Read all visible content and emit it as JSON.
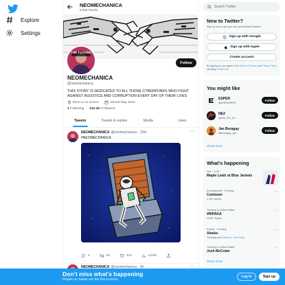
{
  "colors": {
    "accent": "#1d9bf0",
    "text": "#0f1419",
    "muted": "#536471",
    "card_bg": "#f7f9f9"
  },
  "nav": {
    "logo_icon": "twitter-bird-icon",
    "items": [
      {
        "icon": "hashtag-icon",
        "label": "Explore"
      },
      {
        "icon": "gear-icon",
        "label": "Settings"
      }
    ]
  },
  "header": {
    "name": "NEOMECHANICA",
    "tweet_count": "6,369 Tweets"
  },
  "profile": {
    "avatar_text": "THE FUTURE",
    "follow_label": "Follow",
    "name": "NEOMECHANICA",
    "handle": "@neomechanica",
    "bio": "THIS STORY IS DEDICATED TO ALL THOSE CYBERPUNKS WHO FIGHT AGAINST INJUSTICE AND CORRUPTION EVERY DAY OF THEIR LIVES",
    "location": "there is no source",
    "joined": "Joined May 2015",
    "following_count": "1",
    "following_label": "Following",
    "followers_count": "121.1K",
    "followers_label": "Followers"
  },
  "tabs": [
    "Tweets",
    "Tweets & replies",
    "Media",
    "Likes"
  ],
  "tweet": {
    "name": "NEOMECHANICA",
    "handle": "@neomechanica",
    "time": "· 19m",
    "text": "#NEOMECHANICA",
    "replies": "2",
    "retweets": "62",
    "likes": "414",
    "views": "6,846"
  },
  "tweet2": {
    "name": "NEOMECHANICA",
    "handle": "@neomechanica",
    "time": "· 5h"
  },
  "search": {
    "placeholder": "Search Twitter"
  },
  "new_to_twitter": {
    "title": "New to Twitter?",
    "subtitle": "Sign up now to get your own personalized timeline!",
    "google": "Sign up with Google",
    "apple": "Sign up with Apple",
    "create": "Create account",
    "terms_prefix": "By signing up, you agree to the",
    "terms_link": "Terms of Service",
    "terms_and": "and",
    "privacy_link": "Privacy Policy",
    "terms_including": ", including",
    "cookie_link": "Cookie Use."
  },
  "who_to_follow": {
    "title": "You might like",
    "users": [
      {
        "name": "ESPER",
        "handle": "@ESPERRPS",
        "follow": "Follow"
      },
      {
        "name": "NEZ",
        "handle": "@NN_EE_ZZ",
        "follow": "Follow"
      },
      {
        "name": "Jan Buragay",
        "handle": "@buragay_jan",
        "follow": "Follow"
      }
    ],
    "show_more": "Show more"
  },
  "happening": {
    "title": "What's happening",
    "trends": [
      {
        "context": "NHL · LIVE",
        "title": "Maple Leafs at Blue Jackets",
        "sub": ""
      },
      {
        "context": "Entertainment · Trending",
        "title": "Cumtown",
        "sub": "4,781 Tweets"
      },
      {
        "context": "Trending in United States",
        "title": "#RIPAKA",
        "sub": "19.6K Tweets"
      },
      {
        "context": "Politics · Trending",
        "title": "Alaska",
        "sub": "Trending with",
        "links": "Obstruct, John Kirby"
      },
      {
        "context": "Trending in United States",
        "title": "Josh McCown",
        "sub": ""
      }
    ],
    "show_more": "Show more"
  },
  "bottom_bar": {
    "title": "Don’t miss what’s happening",
    "subtitle": "People on Twitter are the first to know.",
    "login": "Log in",
    "signup": "Sign up"
  }
}
